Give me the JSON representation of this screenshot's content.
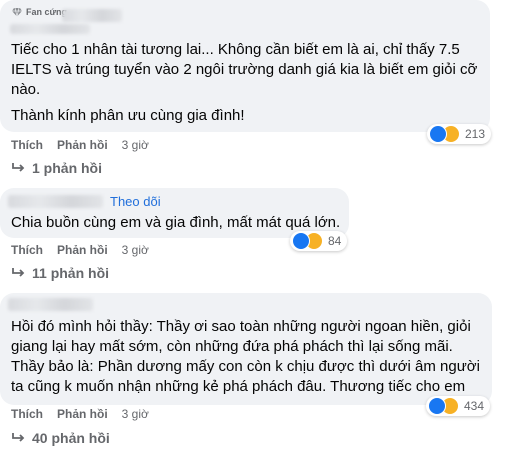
{
  "comments": [
    {
      "badge": "Fan cứng",
      "lines": [
        "Tiếc cho 1 nhân tài tương lai... Không cần biết em là ai, chỉ thấy 7.5",
        "IELTS và trúng tuyển vào 2 ngôi trường danh giá kia là biết em giỏi cỡ",
        "nào."
      ],
      "line_extra": "Thành kính phân ưu cùng gia đình!",
      "like_label": "Thích",
      "reply_label": "Phản hồi",
      "time": "3 giờ",
      "reaction_count": "213",
      "replies_label": "1 phản hồi"
    },
    {
      "follow_label": "Theo dõi",
      "lines": [
        "Chia buồn cùng em và gia đình, mất mát quá lớn."
      ],
      "like_label": "Thích",
      "reply_label": "Phản hồi",
      "time": "3 giờ",
      "reaction_count": "84",
      "replies_label": "11 phản hồi"
    },
    {
      "lines": [
        "Hồi đó mình hỏi thầy: Thầy ơi sao toàn những người ngoan hiền, giỏi",
        "giang lại hay mất sớm, còn những đứa phá phách thì lại sống mãi.",
        "Thầy bảo là: Phần dương mấy con còn k chịu được thì dưới âm người",
        "ta cũng k muốn nhận những kẻ phá phách đâu. Thương tiếc cho em"
      ],
      "like_label": "Thích",
      "reply_label": "Phản hồi",
      "time": "3 giờ",
      "reaction_count": "434",
      "replies_label": "40 phản hồi"
    }
  ],
  "colors": {
    "bubble": "#f0f2f5",
    "text": "#050505",
    "muted": "#65676b",
    "link": "#216fdb",
    "like": "#1877f2",
    "sad": "#f7b125"
  },
  "icons": {
    "badge": "diamond-icon",
    "like": "like-reaction-icon",
    "sad": "sad-reaction-icon",
    "reply_arrow": "reply-arrow-icon"
  }
}
